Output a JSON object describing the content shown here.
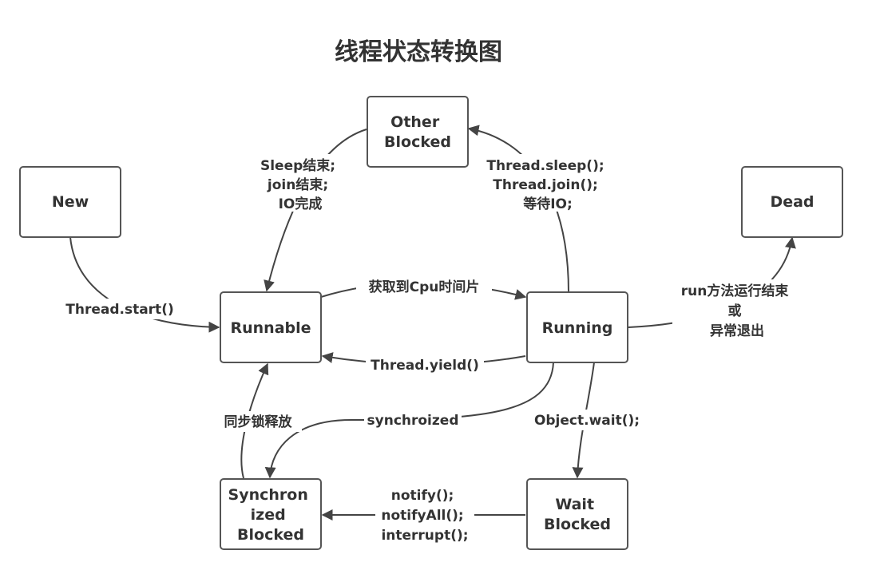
{
  "title": "线程状态转换图",
  "nodes": {
    "new": "New",
    "runnable": "Runnable",
    "running": "Running",
    "dead": "Dead",
    "other_blocked": [
      "Other",
      "Blocked"
    ],
    "wait_blocked": [
      "Wait",
      "Blocked"
    ],
    "sync_blocked": [
      "Synchron",
      "ized",
      "Blocked"
    ]
  },
  "edges": {
    "thread_start": "Thread.start()",
    "get_cpu": "获取到Cpu时间片",
    "yield": "Thread.yield()",
    "sleep_join_io": [
      "Thread.sleep();",
      "Thread.join();",
      "等待IO;"
    ],
    "sleep_end": [
      "Sleep结束;",
      "join结束;",
      "IO完成"
    ],
    "run_end": [
      "run方法运行结束",
      "或",
      "异常退出"
    ],
    "synchroized": "synchroized",
    "object_wait": "Object.wait();",
    "notify": [
      "notify();",
      "notifyAll();",
      "interrupt();"
    ],
    "lock_release": "同步锁释放"
  }
}
